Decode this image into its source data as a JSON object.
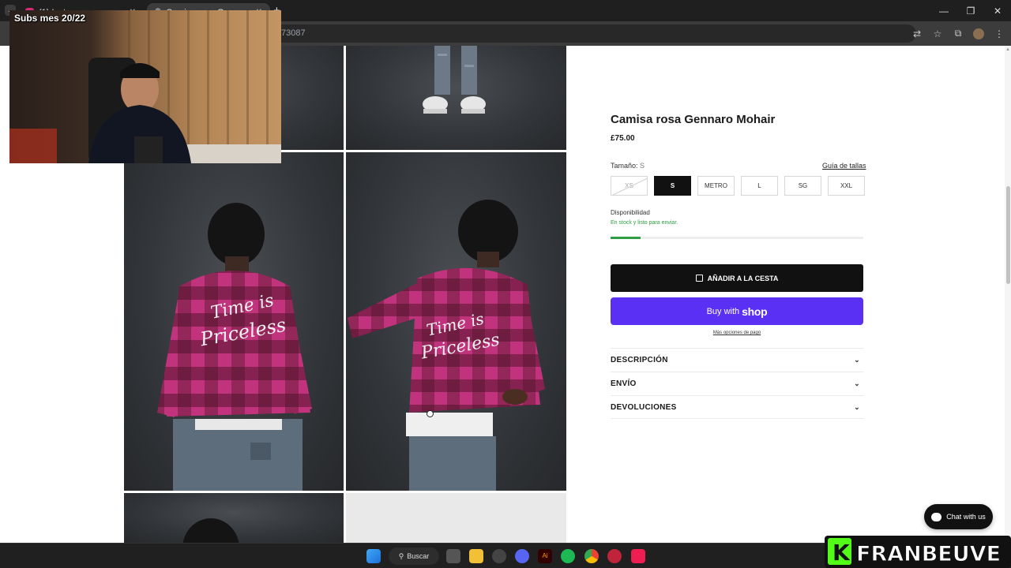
{
  "browser": {
    "tabs": [
      {
        "title": "(1) Instagram"
      },
      {
        "title": "Camisa rosa Gennaro Mohair"
      }
    ],
    "url_fragment": "73087"
  },
  "stream_overlay": {
    "subs_text": "Subs mes 20/22",
    "brand_text": "FRANBEUVE"
  },
  "product": {
    "title": "Camisa rosa Gennaro Mohair",
    "price": "£75.00",
    "size_label": "Tamaño:",
    "size_selected": "S",
    "size_guide": "Guía de tallas",
    "sizes": [
      {
        "label": "XS",
        "state": "disabled"
      },
      {
        "label": "S",
        "state": "selected"
      },
      {
        "label": "METRO",
        "state": "available"
      },
      {
        "label": "L",
        "state": "available"
      },
      {
        "label": "SG",
        "state": "available"
      },
      {
        "label": "XXL",
        "state": "available"
      }
    ],
    "availability_label": "Disponibilidad",
    "availability_text": "En stock y listo para enviar.",
    "stock_level_fraction": 0.12,
    "add_to_cart": "AÑADIR A LA CESTA",
    "buy_with": "Buy with",
    "shop_word": "shop",
    "more_payment": "Más opciones de pago",
    "accordion": [
      {
        "label": "DESCRIPCIÓN"
      },
      {
        "label": "ENVÍO"
      },
      {
        "label": "DEVOLUCIONES"
      }
    ]
  },
  "chat": {
    "label": "Chat with us"
  },
  "taskbar": {
    "search_label": "Buscar"
  },
  "colors": {
    "shop_purple": "#5a31f4",
    "stock_green": "#2ea043",
    "shirt_pink": "#c2337d"
  }
}
